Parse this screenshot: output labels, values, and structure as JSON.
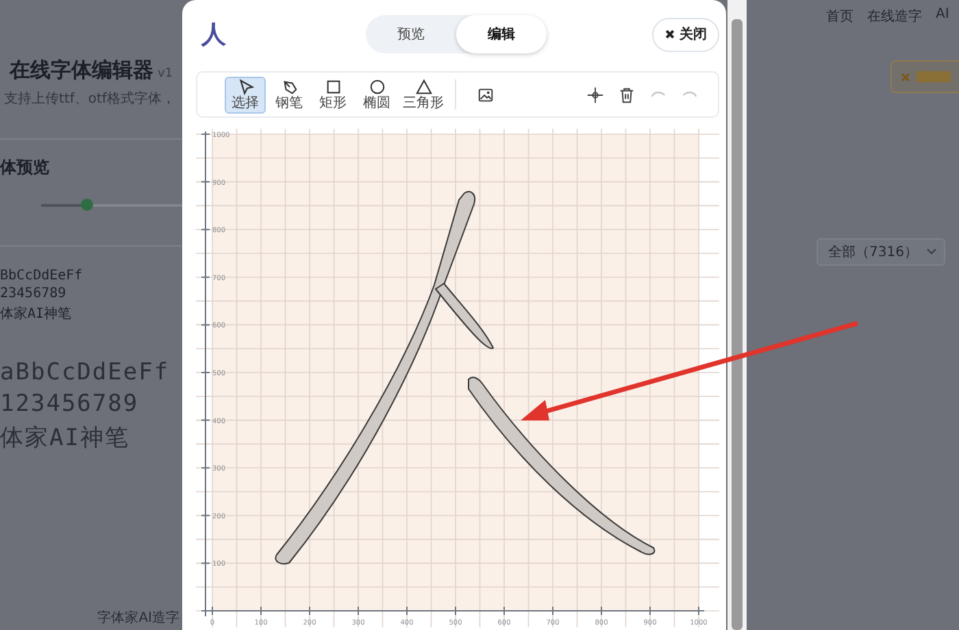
{
  "page": {
    "title": "在线字体编辑器",
    "version": "v1",
    "subtitle": "支持上传ttf、otf格式字体，",
    "preview_heading": "体预览",
    "size_slider": {
      "level": 0.32
    },
    "small_samples": [
      "BbCcDdEeFf",
      "23456789",
      "体家AI神笔"
    ],
    "large_samples": [
      "aBbCcDdEeFf",
      "123456789",
      "体家AI神笔"
    ],
    "footer_label": "字体家AI造字",
    "nav": [
      "首页",
      "在线造字",
      "AI"
    ],
    "filter_select": {
      "value": "全部（7316）"
    }
  },
  "modal": {
    "logo": "人",
    "view_tabs": [
      {
        "label": "预览",
        "selected": false
      },
      {
        "label": "编辑",
        "selected": true
      }
    ],
    "close_button": {
      "label": "关闭"
    },
    "tools": [
      {
        "kind": "pointer",
        "label": "选择",
        "selected": true
      },
      {
        "kind": "pen",
        "label": "钢笔",
        "selected": false
      },
      {
        "kind": "rect",
        "label": "矩形",
        "selected": false
      },
      {
        "kind": "ellipse",
        "label": "椭圆",
        "selected": false
      },
      {
        "kind": "triangle",
        "label": "三角形",
        "selected": false
      },
      {
        "kind": "image",
        "selected": false
      }
    ],
    "actions": [
      {
        "kind": "crosshair",
        "disabled": false
      },
      {
        "kind": "trash",
        "disabled": false
      },
      {
        "kind": "undo",
        "disabled": true
      },
      {
        "kind": "redo",
        "disabled": true
      }
    ],
    "ruler": {
      "y_labels": [
        "1000",
        "900",
        "800",
        "700",
        "600",
        "500",
        "400",
        "300",
        "200",
        "100"
      ],
      "x_labels": [
        "0",
        "100",
        "200",
        "300",
        "400",
        "500",
        "600",
        "700",
        "800",
        "900",
        "1000"
      ]
    }
  }
}
